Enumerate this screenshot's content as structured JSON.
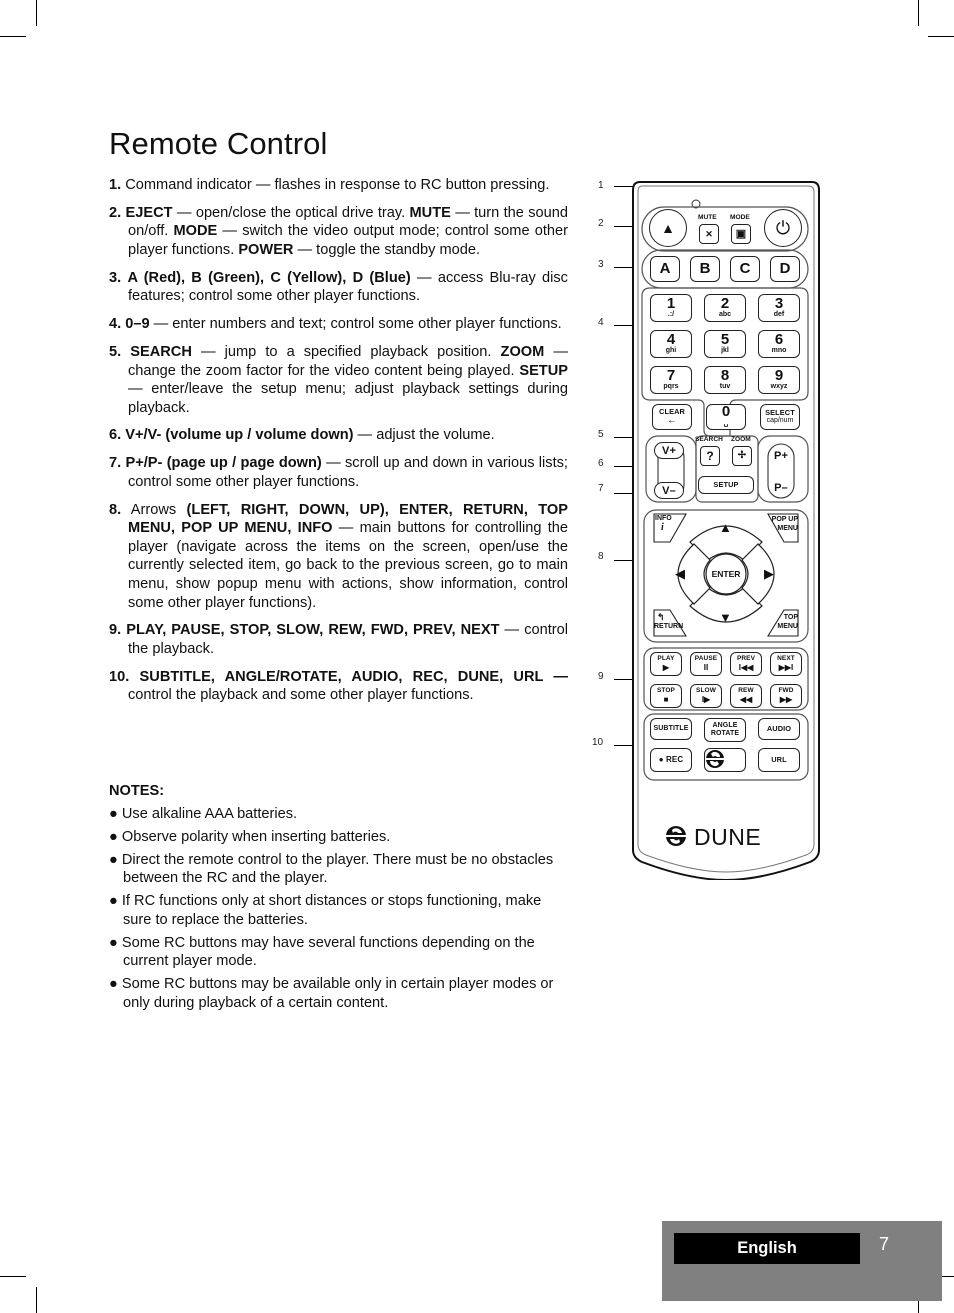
{
  "page": {
    "title": "Remote Control",
    "language": "English",
    "page_number": "7"
  },
  "descriptions": [
    {
      "num": "1.",
      "parts": [
        {
          "b": false,
          "t": "Command indicator — flashes in response to RC button pressing."
        }
      ]
    },
    {
      "num": "2.",
      "parts": [
        {
          "b": true,
          "t": "EJECT"
        },
        {
          "b": false,
          "t": " — open/close the optical drive tray. "
        },
        {
          "b": true,
          "t": "MUTE"
        },
        {
          "b": false,
          "t": " — turn the sound on/off. "
        },
        {
          "b": true,
          "t": "MODE"
        },
        {
          "b": false,
          "t": " — switch the video output mode; control some other player functions. "
        },
        {
          "b": true,
          "t": "POWER"
        },
        {
          "b": false,
          "t": " — toggle the standby mode."
        }
      ]
    },
    {
      "num": "3.",
      "parts": [
        {
          "b": true,
          "t": "A (Red), B (Green), C (Yellow), D (Blue)"
        },
        {
          "b": false,
          "t": " — access Blu-ray disc features; control some other player functions."
        }
      ]
    },
    {
      "num": "4.",
      "parts": [
        {
          "b": true,
          "t": "0–9"
        },
        {
          "b": false,
          "t": " — enter numbers and text; control some other player functions."
        }
      ]
    },
    {
      "num": "5.",
      "parts": [
        {
          "b": true,
          "t": "SEARCH"
        },
        {
          "b": false,
          "t": " — jump to a specified playback position. "
        },
        {
          "b": true,
          "t": "ZOOM"
        },
        {
          "b": false,
          "t": " — change the zoom factor for the video content being played. "
        },
        {
          "b": true,
          "t": "SETUP"
        },
        {
          "b": false,
          "t": " — enter/leave the setup menu; adjust playback settings during playback."
        }
      ]
    },
    {
      "num": "6.",
      "parts": [
        {
          "b": true,
          "t": "V+/V- (volume up / volume down)"
        },
        {
          "b": false,
          "t": " — adjust the volume."
        }
      ]
    },
    {
      "num": "7.",
      "parts": [
        {
          "b": true,
          "t": "P+/P- (page up / page down)"
        },
        {
          "b": false,
          "t": " — scroll up and down in various lists; control some other player functions."
        }
      ]
    },
    {
      "num": "8.",
      "parts": [
        {
          "b": false,
          "t": "Arrows "
        },
        {
          "b": true,
          "t": "(LEFT, RIGHT, DOWN, UP), ENTER, RETURN, TOP MENU, POP UP MENU, INFO"
        },
        {
          "b": false,
          "t": " — main buttons for controlling the player (navigate across the items on the screen, open/use the currently selected item, go back to the previous screen, go to main menu, show popup menu with actions, show information, control some other player functions)."
        }
      ]
    },
    {
      "num": "9.",
      "parts": [
        {
          "b": true,
          "t": "PLAY, PAUSE, STOP, SLOW, REW, FWD, PREV, NEXT"
        },
        {
          "b": false,
          "t": " — control the playback."
        }
      ]
    },
    {
      "num": "10.",
      "parts": [
        {
          "b": true,
          "t": "SUBTITLE, ANGLE/ROTATE, AUDIO, REC, DUNE, URL —"
        },
        {
          "b": false,
          "t": " control the playback and some other player functions."
        }
      ]
    }
  ],
  "notes": {
    "heading": "NOTES:",
    "items": [
      "● Use alkaline AAA batteries.",
      "● Observe polarity when inserting batteries.",
      "● Direct the remote control to the player. There must be no obstacles between the RC and the player.",
      "● If RC functions only at short distances or stops functioning, make sure to replace the batteries.",
      "● Some RC buttons may have several functions depending on the current player mode.",
      "● Some RC buttons may be available only in certain player modes or only during playback of a certain content."
    ]
  },
  "remote": {
    "callouts": [
      "1",
      "2",
      "3",
      "4",
      "5",
      "6",
      "7",
      "8",
      "9",
      "10"
    ],
    "top_labels": {
      "mute": "MUTE",
      "mode": "MODE"
    },
    "icons": {
      "eject": "▲",
      "mute": "🔇",
      "mode": "▣",
      "power": "⏻"
    },
    "color_buttons": [
      "A",
      "B",
      "C",
      "D"
    ],
    "numpad": [
      {
        "digit": "1",
        "letters": ".:/"
      },
      {
        "digit": "2",
        "letters": "abc"
      },
      {
        "digit": "3",
        "letters": "def"
      },
      {
        "digit": "4",
        "letters": "ghi"
      },
      {
        "digit": "5",
        "letters": "jkl"
      },
      {
        "digit": "6",
        "letters": "mno"
      },
      {
        "digit": "7",
        "letters": "pqrs"
      },
      {
        "digit": "8",
        "letters": "tuv"
      },
      {
        "digit": "9",
        "letters": "wxyz"
      }
    ],
    "clear": {
      "label": "CLEAR",
      "glyph": "←"
    },
    "zero": {
      "digit": "0",
      "glyph": "␣"
    },
    "select": {
      "label": "SELECT",
      "sub": "cap/num"
    },
    "search_label": "SEARCH",
    "zoom_label": "ZOOM",
    "search_glyph": "?",
    "zoom_glyph": "✢",
    "setup": "SETUP",
    "vol_up": "V+",
    "vol_down": "V–",
    "page_up": "P+",
    "page_down": "P–",
    "info": {
      "label": "INFO",
      "glyph": "i"
    },
    "popup": {
      "line1": "POP UP",
      "line2": "MENU"
    },
    "return": {
      "label": "RETURN",
      "glyph": "↰"
    },
    "topmenu": {
      "line1": "TOP",
      "line2": "MENU"
    },
    "enter": "ENTER",
    "arrows": {
      "up": "▲",
      "down": "▼",
      "left": "◀",
      "right": "▶"
    },
    "playback": [
      {
        "label": "PLAY",
        "glyph": "▶"
      },
      {
        "label": "PAUSE",
        "glyph": "II"
      },
      {
        "label": "PREV",
        "glyph": "I◀◀"
      },
      {
        "label": "NEXT",
        "glyph": "▶▶I"
      },
      {
        "label": "STOP",
        "glyph": "■"
      },
      {
        "label": "SLOW",
        "glyph": "I▶"
      },
      {
        "label": "REW",
        "glyph": "◀◀"
      },
      {
        "label": "FWD",
        "glyph": "▶▶"
      }
    ],
    "subtitle": "SUBTITLE",
    "angle": {
      "line1": "ANGLE",
      "line2": "ROTATE"
    },
    "audio": "AUDIO",
    "rec": "● REC",
    "url": "URL",
    "brand": "DUNE"
  }
}
